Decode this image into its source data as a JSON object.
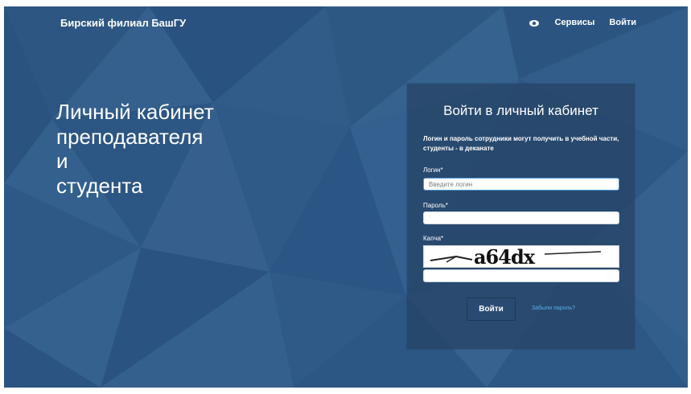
{
  "header": {
    "brand": "Бирский филиал БашГУ",
    "eye_icon": "eye-icon",
    "nav": [
      {
        "label": "Сервисы"
      },
      {
        "label": "Войти"
      }
    ]
  },
  "hero": {
    "lines": [
      "Личный кабинет",
      "преподавателя",
      "и",
      "студента"
    ]
  },
  "login": {
    "title": "Войти в личный кабинет",
    "note": "Логин и пароль сотрудники могут получить в учебной части, студенты - в деканате",
    "login_label": "Логин*",
    "login_placeholder": "Введите логин",
    "login_value": "",
    "password_label": "Пароль*",
    "password_value": "",
    "captcha_label": "Капча*",
    "captcha_text": "a64dx",
    "captcha_value": "",
    "submit_label": "Войти",
    "forgot_label": "Забыли пароль?"
  },
  "colors": {
    "background": "#2f5a86",
    "panel": "#264466",
    "button": "#294b72",
    "link": "#5aaee8"
  }
}
